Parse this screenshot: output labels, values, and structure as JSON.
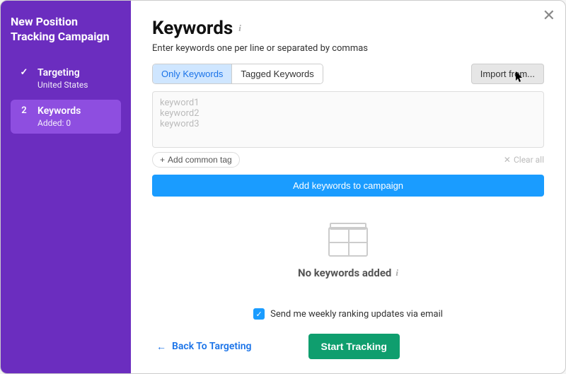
{
  "sidebar": {
    "heading": "New Position Tracking Campaign",
    "steps": [
      {
        "marker": "✓",
        "title": "Targeting",
        "subtitle": "United States"
      },
      {
        "marker": "2",
        "title": "Keywords",
        "subtitle": "Added: 0"
      }
    ]
  },
  "main": {
    "title": "Keywords",
    "subtitle": "Enter keywords one per line or separated by commas",
    "tabs": {
      "only": "Only Keywords",
      "tagged": "Tagged Keywords"
    },
    "import_label": "Import from...",
    "textarea_placeholder": "keyword1\nkeyword2\nkeyword3",
    "add_tag_label": "Add common tag",
    "clear_all_label": "Clear all",
    "add_keywords_label": "Add keywords to campaign",
    "empty_state": "No keywords added",
    "weekly_email_label": "Send me weekly ranking updates via email",
    "back_label": "Back To Targeting",
    "start_label": "Start Tracking"
  }
}
